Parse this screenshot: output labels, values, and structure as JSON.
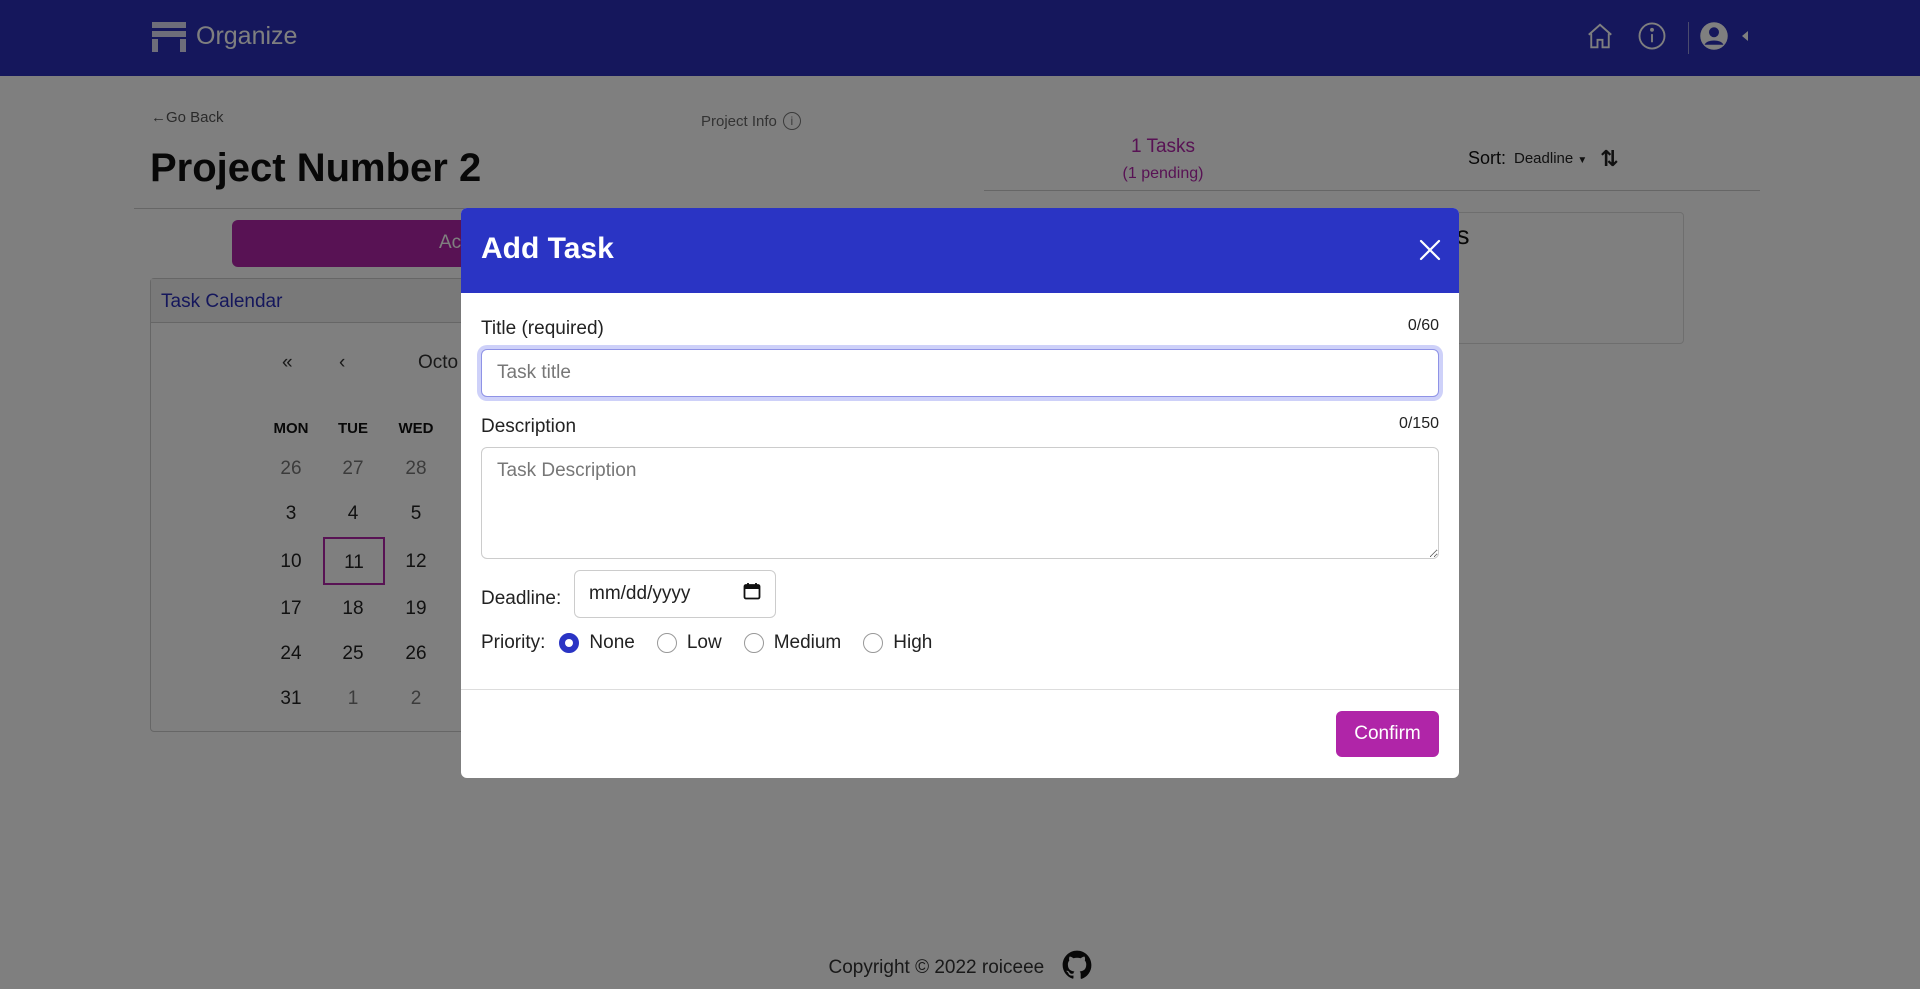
{
  "navbar": {
    "brand": "Organize",
    "colors": {
      "bg": "#2a2fb8"
    }
  },
  "page": {
    "back_label": "Go Back",
    "project_title": "Project Number 2",
    "project_info_label": "Project Info",
    "tasks_count": "1 Tasks",
    "tasks_pending": "(1 pending)",
    "sort_label": "Sort:",
    "sort_value": "Deadline",
    "details_fragment": "ils",
    "add_button_fragment": "Ac"
  },
  "calendar": {
    "header": "Task Calendar",
    "nav": {
      "prev_year": "«",
      "prev_month": "‹",
      "month_fragment": "Octo"
    },
    "weekdays": [
      "MON",
      "TUE",
      "WED"
    ],
    "rows": [
      [
        "26",
        "27",
        "28"
      ],
      [
        "3",
        "4",
        "5"
      ],
      [
        "10",
        "11",
        "12"
      ],
      [
        "17",
        "18",
        "19"
      ],
      [
        "24",
        "25",
        "26"
      ],
      [
        "31",
        "1",
        "2"
      ]
    ],
    "today": "11"
  },
  "footer": {
    "copyright": "Copyright © 2022 roiceee"
  },
  "modal": {
    "title": "Add Task",
    "title_label": "Title (required)",
    "title_count": "0/60",
    "title_placeholder": "Task title",
    "description_label": "Description",
    "description_count": "0/150",
    "description_placeholder": "Task Description",
    "deadline_label": "Deadline:",
    "deadline_placeholder": "mm/dd/yyyy",
    "priority_label": "Priority:",
    "priority_options": [
      "None",
      "Low",
      "Medium",
      "High"
    ],
    "priority_selected": "None",
    "confirm_label": "Confirm",
    "colors": {
      "header": "#2a34c4",
      "accent": "#b025a8"
    }
  }
}
